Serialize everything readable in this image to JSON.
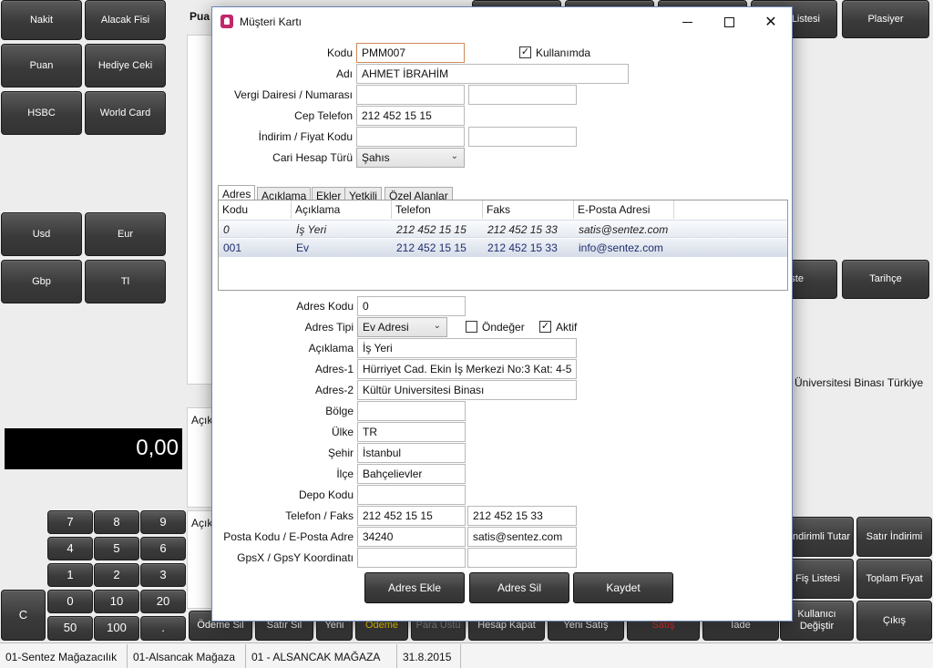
{
  "pay_buttons": [
    "Nakit",
    "Alacak Fisi",
    "Puan",
    "Hediye Ceki",
    "HSBC",
    "World Card"
  ],
  "currency_buttons": [
    "Usd",
    "Eur",
    "Gbp",
    "Tl"
  ],
  "left_panel": {
    "puan_label": "Pua",
    "aciklama1": "Açık",
    "aciklama2": "Açık"
  },
  "total": "0,00",
  "numpad": [
    "7",
    "8",
    "9",
    "4",
    "5",
    "6",
    "1",
    "2",
    "3",
    "0",
    "10",
    "20",
    "50",
    "100",
    "."
  ],
  "numpad_clear": "C",
  "bottom_buttons": [
    "Ödeme Sil",
    "Satır Sil",
    "Yeni",
    "Ödeme",
    "Para Üstü",
    "Hesap Kapat",
    "Yeni Satış",
    "Satış",
    "İade"
  ],
  "right_buttons": {
    "listesi": "Listesi",
    "plasiyer": "Plasiyer",
    "ste": "ste",
    "tarihce": "Tarihçe",
    "indirimli": "ndirimli Tutar",
    "satir_indirimi": "Satır İndirimi",
    "fis_listesi": "Fiş Listesi",
    "toplam_fiyat": "Toplam Fiyat",
    "kullanici": "Kullanıcı Değiştir",
    "cikis": "Çıkış"
  },
  "bg_address_text": "Üniversitesi Binası Türkiye",
  "status_bar": [
    "01-Sentez Mağazacılık",
    "01-Alsancak Mağaza",
    "01 - ALSANCAK MAĞAZA",
    "31.8.2015"
  ],
  "dialog": {
    "title": "Müşteri Kartı",
    "labels": {
      "kodu": "Kodu",
      "adi": "Adı",
      "vergi": "Vergi Dairesi / Numarası",
      "cep": "Cep Telefon",
      "indirim": "İndirim / Fiyat Kodu",
      "cari": "Cari Hesap Türü",
      "kullanimda": "Kullanımda"
    },
    "values": {
      "kodu": "PMM007",
      "adi": "AHMET İBRAHİM",
      "vergi_dairesi": "",
      "vergi_no": "",
      "cep": "212 452 15 15",
      "indirim": "",
      "fiyat_kodu": "",
      "cari": "Şahıs"
    },
    "kullanimda_checked": true,
    "tabs": [
      "Adres",
      "Açıklama",
      "Ekler",
      "Yetkili",
      "Özel Alanlar"
    ],
    "grid_headers": [
      "Kodu",
      "Açıklama",
      "Telefon",
      "Faks",
      "E-Posta Adresi"
    ],
    "grid_rows": [
      {
        "kodu": "0",
        "aciklama": "İş Yeri",
        "telefon": "212 452 15 15",
        "faks": "212 452 15 33",
        "eposta": "satis@sentez.com"
      },
      {
        "kodu": "001",
        "aciklama": "Ev",
        "telefon": "212 452 15 15",
        "faks": "212 452 15 33",
        "eposta": "info@sentez.com"
      }
    ],
    "addr_labels": {
      "adres_kodu": "Adres Kodu",
      "adres_tipi": "Adres Tipi",
      "aciklama": "Açıklama",
      "adres1": "Adres-1",
      "adres2": "Adres-2",
      "bolge": "Bölge",
      "ulke": "Ülke",
      "sehir": "Şehir",
      "ilce": "İlçe",
      "depo": "Depo Kodu",
      "tel_faks": "Telefon / Faks",
      "posta": "Posta Kodu / E-Posta Adre",
      "gps": "GpsX / GpsY Koordinatı",
      "ondeger": "Öndeğer",
      "aktif": "Aktif"
    },
    "addr_values": {
      "adres_kodu": "0",
      "adres_tipi": "Ev Adresi",
      "aciklama": "İş Yeri",
      "adres1": "Hürriyet Cad. Ekin İş Merkezi No:3 Kat: 4-5",
      "adres2": "Kültür Universitesi Binası",
      "bolge": "",
      "ulke": "TR",
      "sehir": "İstanbul",
      "ilce": "Bahçelievler",
      "depo": "",
      "telefon": "212 452 15 15",
      "faks": "212 452 15 33",
      "posta": "34240",
      "eposta": "satis@sentez.com",
      "gpsx": "",
      "gpsy": ""
    },
    "ondeger_checked": false,
    "aktif_checked": true,
    "actions": [
      "Adres Ekle",
      "Adres Sil",
      "Kaydet"
    ]
  }
}
